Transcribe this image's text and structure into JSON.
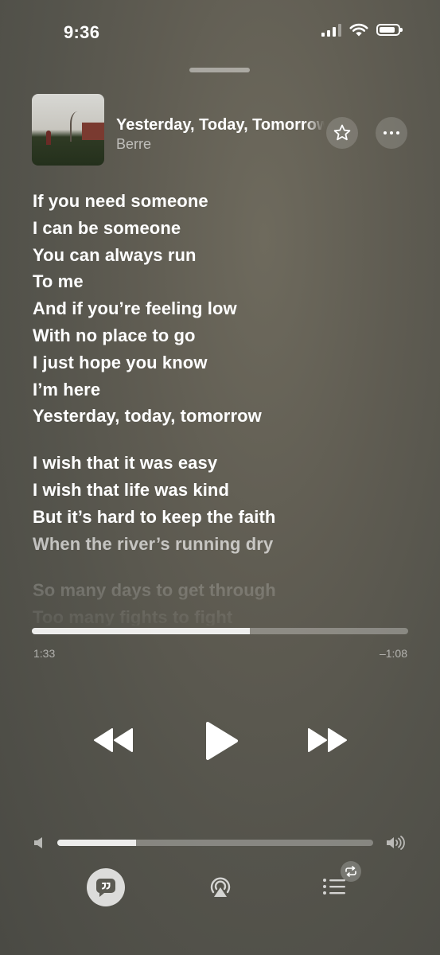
{
  "status_bar": {
    "time": "9:36"
  },
  "now_playing": {
    "title": "Yesterday, Today, Tomorrow",
    "artist": "Berre"
  },
  "lyrics": [
    [
      "If you need someone",
      "I can be someone",
      "You can always run",
      "To me",
      "And if you’re feeling low",
      "With no place to go",
      "I just hope you know",
      "I’m here",
      "Yesterday, today, tomorrow"
    ],
    [
      "I wish that it was easy",
      "I wish that life was kind",
      "But it’s hard to keep the faith",
      "When the river’s running dry"
    ],
    [
      "So many days to get through",
      "Too many fights to fight"
    ]
  ],
  "playback": {
    "elapsed": "1:33",
    "remaining": "–1:08",
    "progress_fraction": 0.58,
    "state": "paused"
  },
  "volume": {
    "level_fraction": 0.25
  },
  "icons": {
    "favorite": "star-icon",
    "more": "ellipsis-icon",
    "rewind": "rewind-icon",
    "play": "play-icon",
    "forward": "fast-forward-icon",
    "lyrics": "quote-bubble-icon",
    "airplay": "airplay-audio-icon",
    "queue": "list-icon",
    "repeat": "repeat-icon"
  }
}
